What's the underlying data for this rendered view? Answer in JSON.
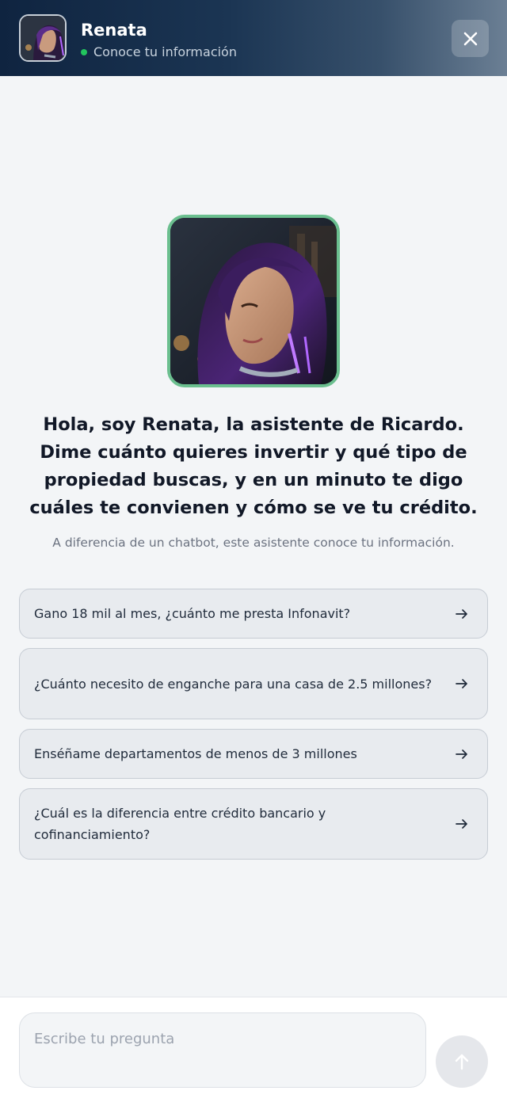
{
  "header": {
    "name": "Renata",
    "status": "Conoce tu información"
  },
  "hero": {
    "headline": "Hola, soy Renata, la asistente de Ricardo. Dime cuánto quieres invertir y qué tipo de propiedad buscas, y en un minuto te digo cuáles te convienen y cómo se ve tu crédito.",
    "subtext": "A diferencia de un chatbot, este asistente conoce tu información."
  },
  "suggestions": [
    {
      "text": "Gano 18 mil al mes, ¿cuánto me presta Infonavit?"
    },
    {
      "text": "¿Cuánto necesito de enganche para una casa de 2.5 millones?"
    },
    {
      "text": "Enséñame departamentos de menos de 3 millones"
    },
    {
      "text": "¿Cuál es la diferencia entre crédito bancario y cofinanciamiento?"
    }
  ],
  "composer": {
    "placeholder": "Escribe tu pregunta"
  },
  "colors": {
    "accent_green": "#22c55e",
    "avatar_border": "#6bbf8f",
    "header_dark": "#0f2440"
  },
  "icons": {
    "close": "close-icon",
    "arrow": "arrow-right-icon",
    "send": "arrow-up-icon"
  }
}
